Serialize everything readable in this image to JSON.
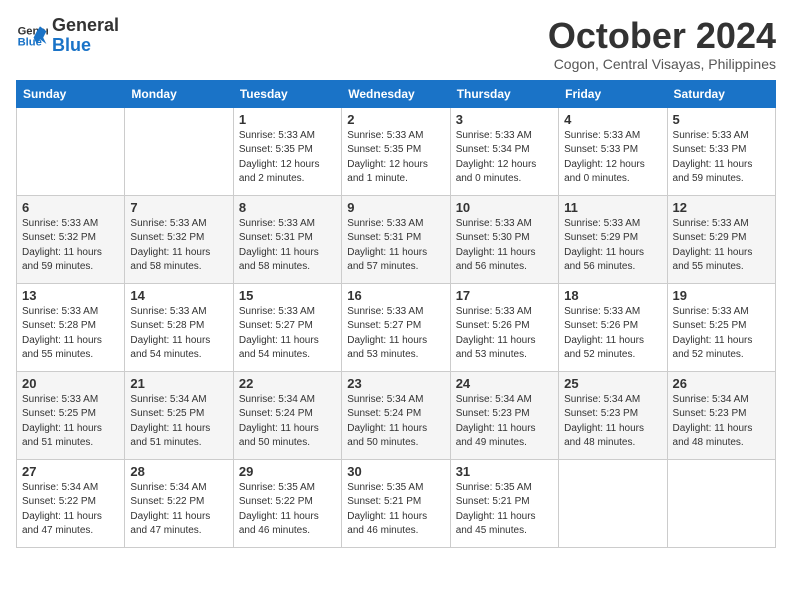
{
  "header": {
    "logo_line1": "General",
    "logo_line2": "Blue",
    "month_title": "October 2024",
    "location": "Cogon, Central Visayas, Philippines"
  },
  "weekdays": [
    "Sunday",
    "Monday",
    "Tuesday",
    "Wednesday",
    "Thursday",
    "Friday",
    "Saturday"
  ],
  "weeks": [
    [
      {
        "day": "",
        "detail": ""
      },
      {
        "day": "",
        "detail": ""
      },
      {
        "day": "1",
        "detail": "Sunrise: 5:33 AM\nSunset: 5:35 PM\nDaylight: 12 hours\nand 2 minutes."
      },
      {
        "day": "2",
        "detail": "Sunrise: 5:33 AM\nSunset: 5:35 PM\nDaylight: 12 hours\nand 1 minute."
      },
      {
        "day": "3",
        "detail": "Sunrise: 5:33 AM\nSunset: 5:34 PM\nDaylight: 12 hours\nand 0 minutes."
      },
      {
        "day": "4",
        "detail": "Sunrise: 5:33 AM\nSunset: 5:33 PM\nDaylight: 12 hours\nand 0 minutes."
      },
      {
        "day": "5",
        "detail": "Sunrise: 5:33 AM\nSunset: 5:33 PM\nDaylight: 11 hours\nand 59 minutes."
      }
    ],
    [
      {
        "day": "6",
        "detail": "Sunrise: 5:33 AM\nSunset: 5:32 PM\nDaylight: 11 hours\nand 59 minutes."
      },
      {
        "day": "7",
        "detail": "Sunrise: 5:33 AM\nSunset: 5:32 PM\nDaylight: 11 hours\nand 58 minutes."
      },
      {
        "day": "8",
        "detail": "Sunrise: 5:33 AM\nSunset: 5:31 PM\nDaylight: 11 hours\nand 58 minutes."
      },
      {
        "day": "9",
        "detail": "Sunrise: 5:33 AM\nSunset: 5:31 PM\nDaylight: 11 hours\nand 57 minutes."
      },
      {
        "day": "10",
        "detail": "Sunrise: 5:33 AM\nSunset: 5:30 PM\nDaylight: 11 hours\nand 56 minutes."
      },
      {
        "day": "11",
        "detail": "Sunrise: 5:33 AM\nSunset: 5:29 PM\nDaylight: 11 hours\nand 56 minutes."
      },
      {
        "day": "12",
        "detail": "Sunrise: 5:33 AM\nSunset: 5:29 PM\nDaylight: 11 hours\nand 55 minutes."
      }
    ],
    [
      {
        "day": "13",
        "detail": "Sunrise: 5:33 AM\nSunset: 5:28 PM\nDaylight: 11 hours\nand 55 minutes."
      },
      {
        "day": "14",
        "detail": "Sunrise: 5:33 AM\nSunset: 5:28 PM\nDaylight: 11 hours\nand 54 minutes."
      },
      {
        "day": "15",
        "detail": "Sunrise: 5:33 AM\nSunset: 5:27 PM\nDaylight: 11 hours\nand 54 minutes."
      },
      {
        "day": "16",
        "detail": "Sunrise: 5:33 AM\nSunset: 5:27 PM\nDaylight: 11 hours\nand 53 minutes."
      },
      {
        "day": "17",
        "detail": "Sunrise: 5:33 AM\nSunset: 5:26 PM\nDaylight: 11 hours\nand 53 minutes."
      },
      {
        "day": "18",
        "detail": "Sunrise: 5:33 AM\nSunset: 5:26 PM\nDaylight: 11 hours\nand 52 minutes."
      },
      {
        "day": "19",
        "detail": "Sunrise: 5:33 AM\nSunset: 5:25 PM\nDaylight: 11 hours\nand 52 minutes."
      }
    ],
    [
      {
        "day": "20",
        "detail": "Sunrise: 5:33 AM\nSunset: 5:25 PM\nDaylight: 11 hours\nand 51 minutes."
      },
      {
        "day": "21",
        "detail": "Sunrise: 5:34 AM\nSunset: 5:25 PM\nDaylight: 11 hours\nand 51 minutes."
      },
      {
        "day": "22",
        "detail": "Sunrise: 5:34 AM\nSunset: 5:24 PM\nDaylight: 11 hours\nand 50 minutes."
      },
      {
        "day": "23",
        "detail": "Sunrise: 5:34 AM\nSunset: 5:24 PM\nDaylight: 11 hours\nand 50 minutes."
      },
      {
        "day": "24",
        "detail": "Sunrise: 5:34 AM\nSunset: 5:23 PM\nDaylight: 11 hours\nand 49 minutes."
      },
      {
        "day": "25",
        "detail": "Sunrise: 5:34 AM\nSunset: 5:23 PM\nDaylight: 11 hours\nand 48 minutes."
      },
      {
        "day": "26",
        "detail": "Sunrise: 5:34 AM\nSunset: 5:23 PM\nDaylight: 11 hours\nand 48 minutes."
      }
    ],
    [
      {
        "day": "27",
        "detail": "Sunrise: 5:34 AM\nSunset: 5:22 PM\nDaylight: 11 hours\nand 47 minutes."
      },
      {
        "day": "28",
        "detail": "Sunrise: 5:34 AM\nSunset: 5:22 PM\nDaylight: 11 hours\nand 47 minutes."
      },
      {
        "day": "29",
        "detail": "Sunrise: 5:35 AM\nSunset: 5:22 PM\nDaylight: 11 hours\nand 46 minutes."
      },
      {
        "day": "30",
        "detail": "Sunrise: 5:35 AM\nSunset: 5:21 PM\nDaylight: 11 hours\nand 46 minutes."
      },
      {
        "day": "31",
        "detail": "Sunrise: 5:35 AM\nSunset: 5:21 PM\nDaylight: 11 hours\nand 45 minutes."
      },
      {
        "day": "",
        "detail": ""
      },
      {
        "day": "",
        "detail": ""
      }
    ]
  ]
}
